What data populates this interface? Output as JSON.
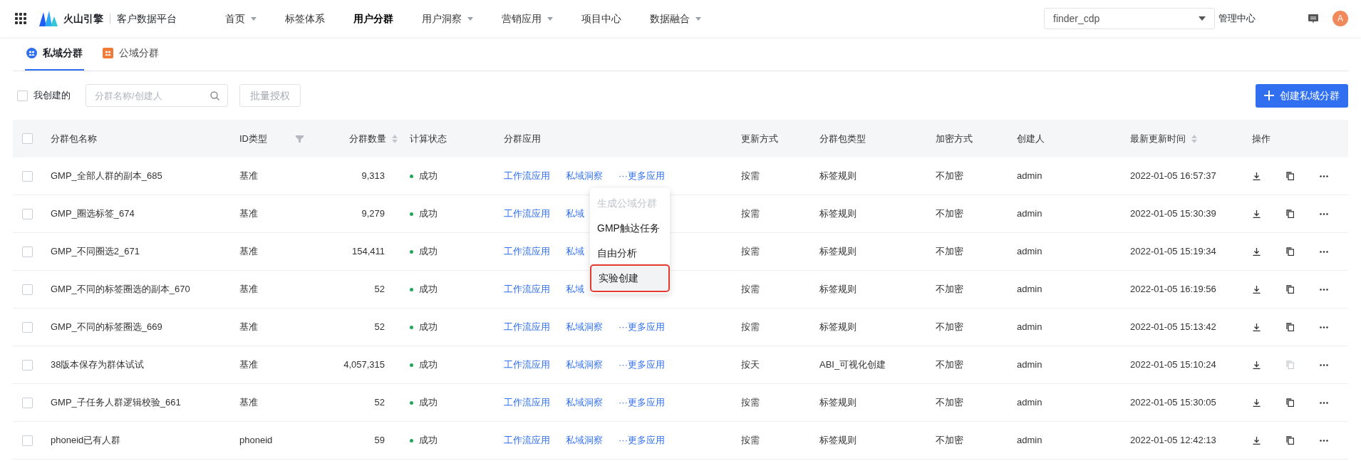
{
  "header": {
    "brand": "火山引擎",
    "product": "客户数据平台",
    "nav": [
      {
        "label": "首页",
        "dropdown": true,
        "selected": false
      },
      {
        "label": "标签体系",
        "dropdown": false,
        "selected": false
      },
      {
        "label": "用户分群",
        "dropdown": false,
        "selected": true
      },
      {
        "label": "用户洞察",
        "dropdown": true,
        "selected": false
      },
      {
        "label": "营销应用",
        "dropdown": true,
        "selected": false
      },
      {
        "label": "项目中心",
        "dropdown": false,
        "selected": false
      },
      {
        "label": "数据融合",
        "dropdown": true,
        "selected": false
      }
    ],
    "project_select": {
      "value": "finder_cdp"
    },
    "admin_link": "管理中心",
    "avatar": "A"
  },
  "tabs": [
    {
      "label": "私域分群",
      "selected": true
    },
    {
      "label": "公域分群",
      "selected": false
    }
  ],
  "toolbar": {
    "mine_only": {
      "label": "我创建的",
      "checked": false
    },
    "search": {
      "placeholder": "分群名称/创建人"
    },
    "batch_button": {
      "label": "批量授权",
      "disabled": true
    },
    "create_button": "创建私域分群"
  },
  "table": {
    "select_all": {
      "checked": false
    },
    "columns": [
      {
        "label": "分群包名称",
        "sort": false,
        "filter": false
      },
      {
        "label": "ID类型",
        "sort": false,
        "filter": true
      },
      {
        "label": "分群数量",
        "sort": true,
        "filter": false
      },
      {
        "label": "计算状态",
        "sort": false,
        "filter": false
      },
      {
        "label": "分群应用",
        "sort": false,
        "filter": false
      },
      {
        "label": "更新方式",
        "sort": false,
        "filter": false
      },
      {
        "label": "分群包类型",
        "sort": false,
        "filter": false
      },
      {
        "label": "加密方式",
        "sort": false,
        "filter": false
      },
      {
        "label": "创建人",
        "sort": false,
        "filter": false
      },
      {
        "label": "最新更新时间",
        "sort": true,
        "filter": false
      },
      {
        "label": "操作",
        "sort": false,
        "filter": false
      }
    ],
    "rows": [
      {
        "checked": false,
        "name": "GMP_全部人群的副本_685",
        "id_type": "基准",
        "count": "9,313",
        "status": "成功",
        "apps": [
          "工作流应用",
          "私域洞察",
          "···更多应用"
        ],
        "update": "按需",
        "pkg_type": "标签规则",
        "encryption": "不加密",
        "creator": "admin",
        "updated": "2022-01-05 16:57:37",
        "copy_disabled": false
      },
      {
        "checked": false,
        "name": "GMP_圈选标签_674",
        "id_type": "基准",
        "count": "9,279",
        "status": "成功",
        "apps": [
          "工作流应用",
          "私域"
        ],
        "update": "按需",
        "pkg_type": "标签规则",
        "encryption": "不加密",
        "creator": "admin",
        "updated": "2022-01-05 15:30:39",
        "copy_disabled": false
      },
      {
        "checked": false,
        "name": "GMP_不同圈选2_671",
        "id_type": "基准",
        "count": "154,411",
        "status": "成功",
        "apps": [
          "工作流应用",
          "私域"
        ],
        "update": "按需",
        "pkg_type": "标签规则",
        "encryption": "不加密",
        "creator": "admin",
        "updated": "2022-01-05 15:19:34",
        "copy_disabled": false
      },
      {
        "checked": false,
        "name": "GMP_不同的标签圈选的副本_670",
        "id_type": "基准",
        "count": "52",
        "status": "成功",
        "apps": [
          "工作流应用",
          "私域"
        ],
        "update": "按需",
        "pkg_type": "标签规则",
        "encryption": "不加密",
        "creator": "admin",
        "updated": "2022-01-05 16:19:56",
        "copy_disabled": false
      },
      {
        "checked": false,
        "name": "GMP_不同的标签圈选_669",
        "id_type": "基准",
        "count": "52",
        "status": "成功",
        "apps": [
          "工作流应用",
          "私域洞察",
          "···更多应用"
        ],
        "update": "按需",
        "pkg_type": "标签规则",
        "encryption": "不加密",
        "creator": "admin",
        "updated": "2022-01-05 15:13:42",
        "copy_disabled": false
      },
      {
        "checked": false,
        "name": "38版本保存为群体试试",
        "id_type": "基准",
        "count": "4,057,315",
        "status": "成功",
        "apps": [
          "工作流应用",
          "私域洞察",
          "···更多应用"
        ],
        "update": "按天",
        "pkg_type": "ABI_可视化创建",
        "encryption": "不加密",
        "creator": "admin",
        "updated": "2022-01-05 15:10:24",
        "copy_disabled": true
      },
      {
        "checked": false,
        "name": "GMP_子任务人群逻辑校验_661",
        "id_type": "基准",
        "count": "52",
        "status": "成功",
        "apps": [
          "工作流应用",
          "私域洞察",
          "···更多应用"
        ],
        "update": "按需",
        "pkg_type": "标签规则",
        "encryption": "不加密",
        "creator": "admin",
        "updated": "2022-01-05 15:30:05",
        "copy_disabled": false
      },
      {
        "checked": false,
        "name": "phoneid已有人群",
        "id_type": "phoneid",
        "count": "59",
        "status": "成功",
        "apps": [
          "工作流应用",
          "私域洞察",
          "···更多应用"
        ],
        "update": "按需",
        "pkg_type": "标签规则",
        "encryption": "不加密",
        "creator": "admin",
        "updated": "2022-01-05 12:42:13",
        "copy_disabled": false
      }
    ]
  },
  "more_menu": [
    {
      "label": "生成公域分群",
      "disabled": true,
      "highlighted": false
    },
    {
      "label": "GMP触达任务",
      "disabled": false,
      "highlighted": false
    },
    {
      "label": "自由分析",
      "disabled": false,
      "highlighted": false
    },
    {
      "label": "实验创建",
      "disabled": false,
      "highlighted": true
    }
  ]
}
